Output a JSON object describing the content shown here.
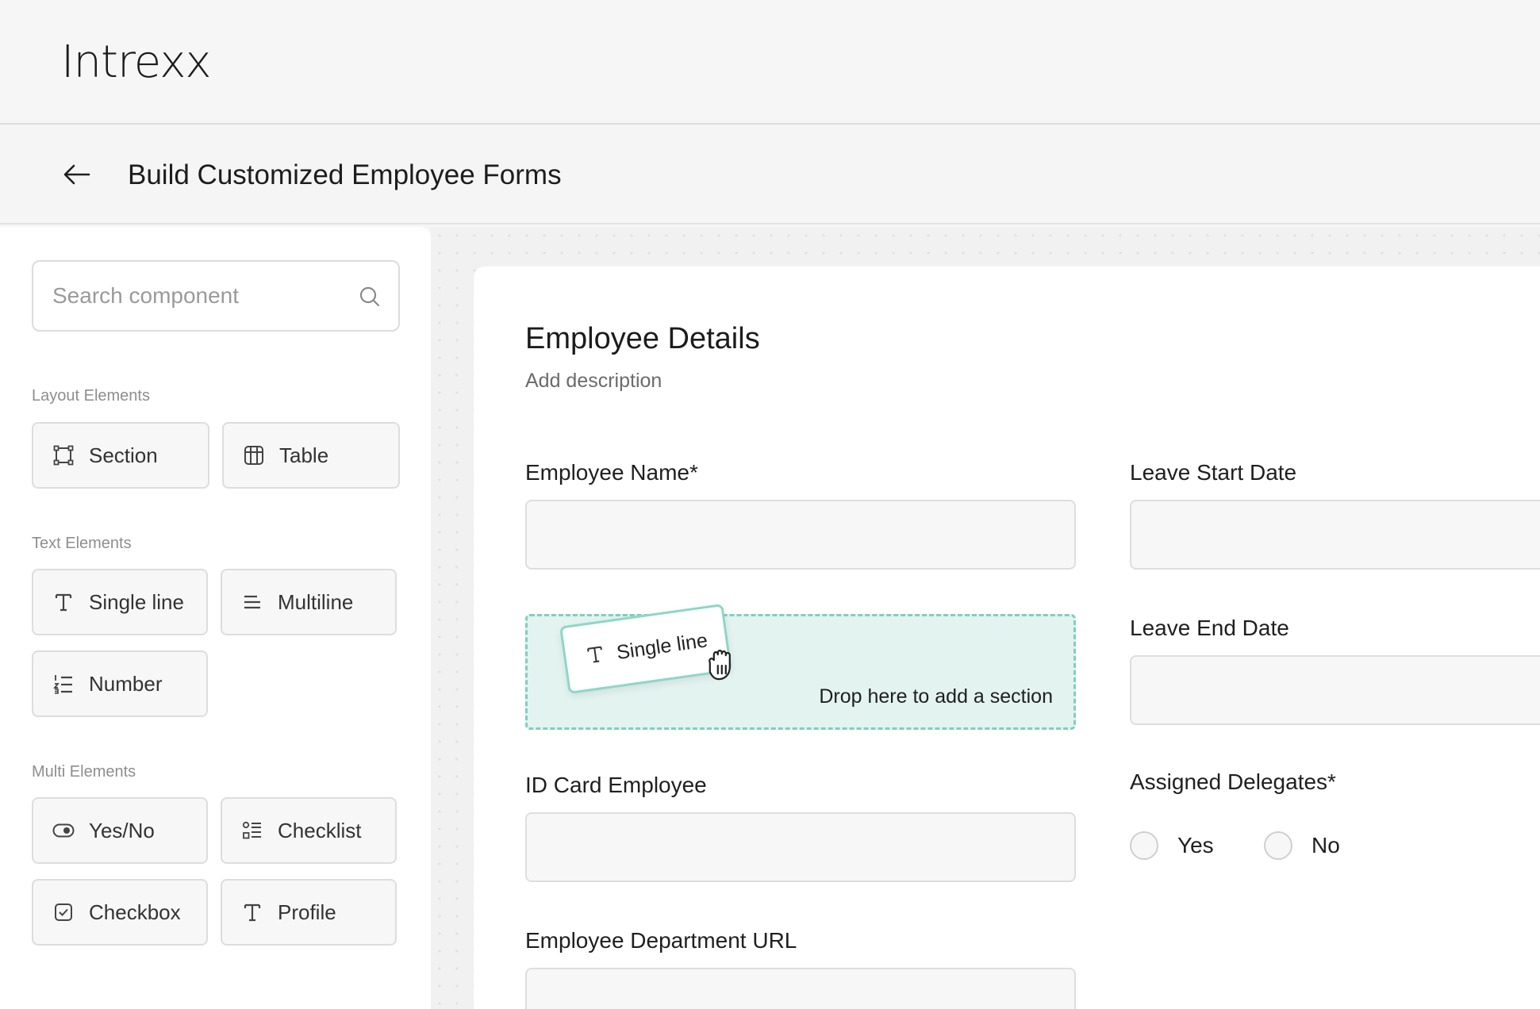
{
  "app": {
    "logo": "Intrexx"
  },
  "header": {
    "title": "Build Customized Employee Forms"
  },
  "sidebar": {
    "search_placeholder": "Search component",
    "groups": {
      "layout": {
        "label": "Layout Elements",
        "items": [
          {
            "label": "Section",
            "icon": "section-icon"
          },
          {
            "label": "Table",
            "icon": "table-icon"
          }
        ]
      },
      "text": {
        "label": "Text Elements",
        "items": [
          {
            "label": "Single line",
            "icon": "text-t-icon"
          },
          {
            "label": "Multiline",
            "icon": "multiline-icon"
          },
          {
            "label": "Number",
            "icon": "numbered-list-icon"
          }
        ]
      },
      "multi": {
        "label": "Multi Elements",
        "items": [
          {
            "label": "Yes/No",
            "icon": "toggle-icon"
          },
          {
            "label": "Checklist",
            "icon": "checklist-icon"
          },
          {
            "label": "Checkbox",
            "icon": "checkbox-icon"
          },
          {
            "label": "Profile",
            "icon": "text-t-icon"
          }
        ]
      }
    }
  },
  "form": {
    "title": "Employee Details",
    "description": "Add description",
    "fields": {
      "employee_name": "Employee Name*",
      "leave_start": "Leave Start Date",
      "leave_end": "Leave End Date",
      "id_card": "ID Card Employee",
      "delegates": "Assigned Delegates*",
      "department_url": "Employee Department URL"
    },
    "radio_options": [
      "Yes",
      "No"
    ],
    "drop_zone": {
      "text": "Drop here to add a section",
      "dragged_label": "Single line"
    }
  },
  "colors": {
    "accent": "#7fcfbf",
    "drop_bg": "#e3f3f0"
  }
}
